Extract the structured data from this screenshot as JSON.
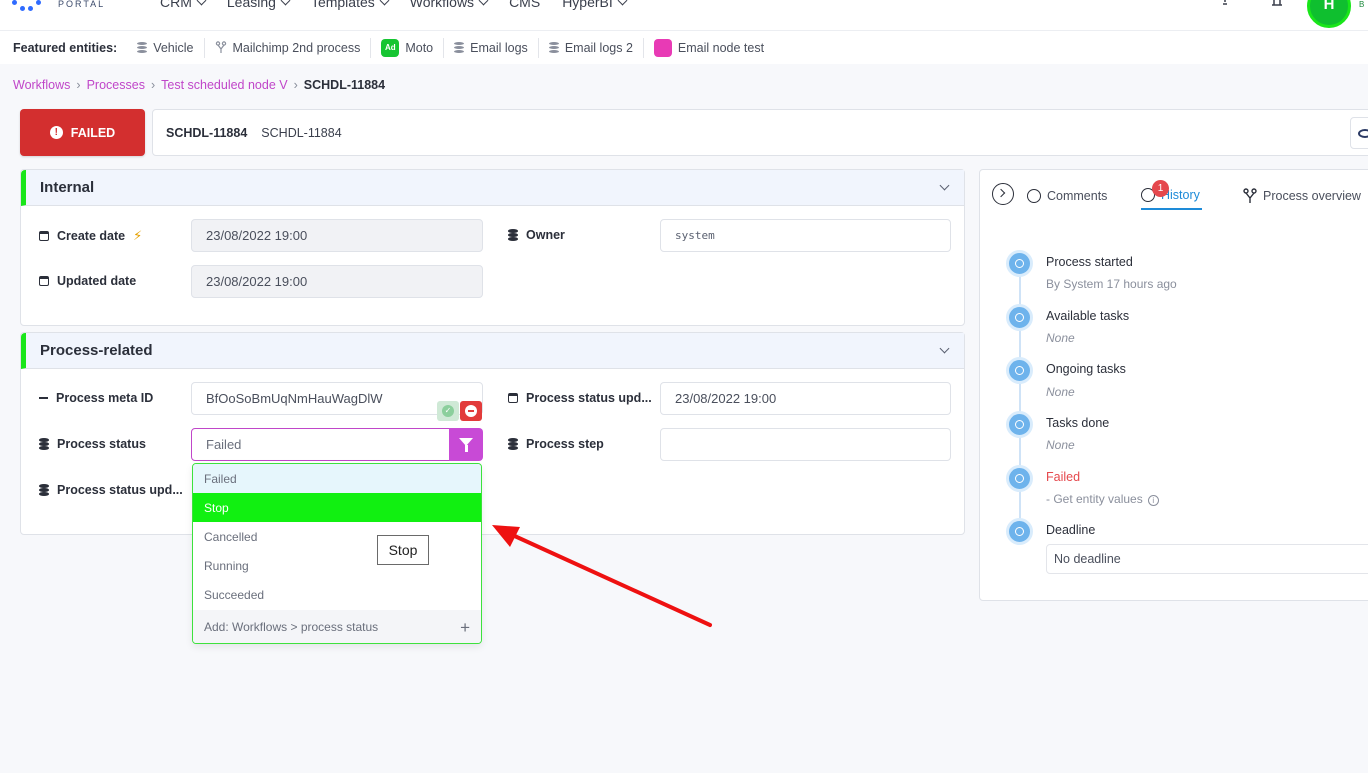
{
  "nav": {
    "logo_text": "PORTAL",
    "menu": [
      "CRM",
      "Leasing",
      "Templates",
      "Workflows",
      "CMS",
      "HyperBI"
    ],
    "avatar_initial": "H",
    "avatar_sub": "B"
  },
  "featured": {
    "label": "Featured entities:",
    "items": [
      {
        "label": "Vehicle",
        "icon": "database-icon"
      },
      {
        "label": "Mailchimp 2nd process",
        "icon": "fork-icon"
      },
      {
        "label": "Moto",
        "icon": "ad-badge-icon",
        "badge": "Ad"
      },
      {
        "label": "Email logs",
        "icon": "database-icon"
      },
      {
        "label": "Email logs 2",
        "icon": "database-icon"
      },
      {
        "label": "Email node test",
        "icon": "pink-badge-icon"
      }
    ]
  },
  "breadcrumb": {
    "items": [
      "Workflows",
      "Processes",
      "Test scheduled node V"
    ],
    "separator": "›",
    "current": "SCHDL-11884"
  },
  "status": {
    "label": "FAILED",
    "color": "#d32f2f"
  },
  "id_bar": {
    "main": "SCHDL-11884",
    "sub": "SCHDL-11884"
  },
  "internal": {
    "title": "Internal",
    "create_date_label": "Create date",
    "create_date_value": "23/08/2022 19:00",
    "updated_date_label": "Updated date",
    "updated_date_value": "23/08/2022 19:00",
    "owner_label": "Owner",
    "owner_value": "system"
  },
  "process_related": {
    "title": "Process-related",
    "meta_id_label": "Process meta ID",
    "meta_id_value": "BfOoSoBmUqNmHauWagDlW",
    "status_updated_label": "Process status upd...",
    "status_updated_value": "23/08/2022 19:00",
    "status_label": "Process status",
    "status_value": "Failed",
    "step_label": "Process step",
    "step_value": "",
    "status_upd2_label": "Process status upd..."
  },
  "dropdown": {
    "options": [
      "Failed",
      "Stop",
      "Cancelled",
      "Running",
      "Succeeded"
    ],
    "selected": "Stop",
    "add_label": "Add: Workflows > process status",
    "tooltip": "Stop"
  },
  "right_panel": {
    "tabs": [
      {
        "label": "Comments",
        "icon": "comment-icon"
      },
      {
        "label": "History",
        "icon": "history-icon",
        "badge": "1"
      },
      {
        "label": "Process overview",
        "icon": "fork-icon"
      }
    ],
    "active_tab": "History",
    "timeline": [
      {
        "title": "Process started",
        "sub": "By System 17 hours ago",
        "icon": "power-icon"
      },
      {
        "title": "Available tasks",
        "sub": "None",
        "icon": "inbox-icon"
      },
      {
        "title": "Ongoing tasks",
        "sub": "None",
        "icon": "refresh-icon"
      },
      {
        "title": "Tasks done",
        "sub": "None",
        "icon": "list-icon"
      },
      {
        "title": "Failed",
        "sub": "- Get entity values",
        "icon": "x-circle-icon"
      },
      {
        "title": "Deadline",
        "sub": "No deadline",
        "icon": "alarm-icon"
      }
    ]
  },
  "colors": {
    "accent_green": "#19e619",
    "accent_purple": "#c84ad6",
    "active_blue": "#1e8bd8",
    "failed_red": "#e5484d"
  }
}
